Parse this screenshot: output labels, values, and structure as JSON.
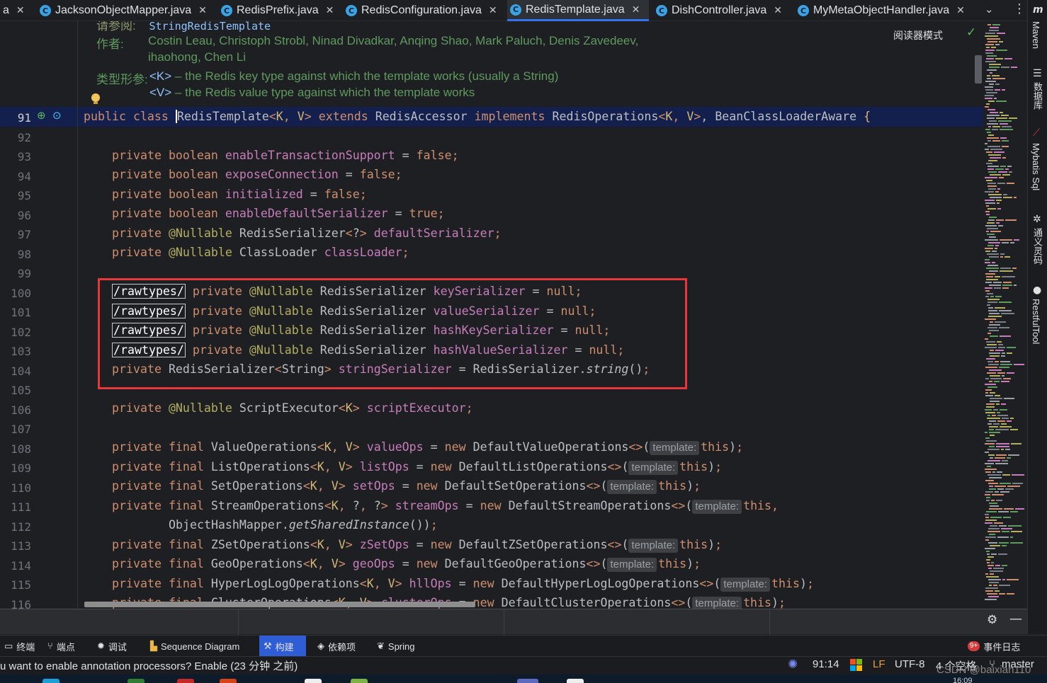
{
  "tabs": [
    {
      "label": "a",
      "partial": true
    },
    {
      "label": "JacksonObjectMapper.java"
    },
    {
      "label": "RedisPrefix.java"
    },
    {
      "label": "RedisConfiguration.java"
    },
    {
      "label": "RedisTemplate.java",
      "active": true
    },
    {
      "label": "DishController.java"
    },
    {
      "label": "MyMetaObjectHandler.java"
    }
  ],
  "editor": {
    "reader_mode": "阅读器模式",
    "doc": {
      "see_label": "请参阅:",
      "see_value": "StringRedisTemplate",
      "author_label": "作者:",
      "authors_line1": "Costin Leau, Christoph Strobl, Ninad Divadkar, Anqing Shao, Mark Paluch, Denis Zavedeev,",
      "authors_line2": "ihaohong, Chen Li",
      "type_params_label": "类型形参:",
      "k_param": "<K>",
      "k_desc": " – the Redis key type against which the template works (usually a String)",
      "v_param": "<V>",
      "v_desc": " – the Redis value type against which the template works"
    },
    "line_numbers": [
      "91",
      "92",
      "93",
      "94",
      "95",
      "96",
      "97",
      "98",
      "99",
      "100",
      "101",
      "102",
      "103",
      "104",
      "105",
      "106",
      "107",
      "108",
      "109",
      "110",
      "111",
      "112",
      "113",
      "114",
      "115",
      "116"
    ],
    "code": {
      "l91": {
        "public": "public",
        "class": "class",
        "name": "RedisTemplate",
        "k": "K",
        "v": "V",
        "extends": "extends",
        "accessor": "RedisAccessor",
        "implements": "implements",
        "ops": "RedisOperations",
        "aware": "BeanClassLoaderAware"
      },
      "private": "private",
      "boolean": "boolean",
      "final": "final",
      "nullable": "@Nullable",
      "false": "false",
      "true": "true",
      "null": "null",
      "new": "new",
      "this": "this",
      "rawtypes": "/rawtypes/",
      "hint": "template:",
      "f_enableTx": "enableTransactionSupport",
      "f_expose": "exposeConnection",
      "f_init": "initialized",
      "f_enableDef": "enableDefaultSerializer",
      "t_serializer": "RedisSerializer",
      "f_defSer": "defaultSerializer",
      "t_classloader": "ClassLoader",
      "f_classLoader": "classLoader",
      "f_keySer": "keySerializer",
      "f_valueSer": "valueSerializer",
      "f_hashKeySer": "hashKeySerializer",
      "f_hashValueSer": "hashValueSerializer",
      "t_string": "String",
      "f_strSer": "stringSerializer",
      "m_string": "string",
      "t_scriptExec": "ScriptExecutor",
      "f_scriptExec": "scriptExecutor",
      "t_valueOps": "ValueOperations",
      "f_valueOps": "valueOps",
      "c_valueOps": "DefaultValueOperations",
      "t_listOps": "ListOperations",
      "f_listOps": "listOps",
      "c_listOps": "DefaultListOperations",
      "t_setOps": "SetOperations",
      "f_setOps": "setOps",
      "c_setOps": "DefaultSetOperations",
      "t_streamOps": "StreamOperations",
      "f_streamOps": "streamOps",
      "c_streamOps": "DefaultStreamOperations",
      "t_hashMapper": "ObjectHashMapper",
      "m_shared": "getSharedInstance",
      "t_zsetOps": "ZSetOperations",
      "f_zsetOps": "zSetOps",
      "c_zsetOps": "DefaultZSetOperations",
      "t_geoOps": "GeoOperations",
      "f_geoOps": "geoOps",
      "c_geoOps": "DefaultGeoOperations",
      "t_hllOps": "HyperLogLogOperations",
      "f_hllOps": "hllOps",
      "c_hllOps": "DefaultHyperLogLogOperations",
      "t_clusterOps": "ClusterOperations",
      "f_clusterOps": "clusterOps",
      "c_clusterOps": "DefaultClusterOperations"
    }
  },
  "right_tools": [
    "Maven",
    "数据库",
    "Mybatis Sql",
    "通义灵码",
    "RestfulTool"
  ],
  "tool_windows": [
    {
      "label": "终端",
      "icon": "terminal-icon"
    },
    {
      "label": "端点",
      "icon": "endpoints-icon"
    },
    {
      "label": "调试",
      "icon": "debug-icon"
    },
    {
      "label": "Sequence Diagram",
      "icon": "sequence-icon"
    },
    {
      "label": "构建",
      "icon": "build-icon",
      "active": true
    },
    {
      "label": "依赖项",
      "icon": "dependencies-icon"
    },
    {
      "label": "Spring",
      "icon": "spring-icon"
    }
  ],
  "event_log": {
    "badge": "9+",
    "label": "事件日志"
  },
  "status": {
    "message": "u want to enable annotation processors? Enable (23 分钟 之前)",
    "position": "91:14",
    "line_sep": "LF",
    "encoding": "UTF-8",
    "indent": "4 个空格",
    "branch": "master",
    "watermark": "CSDN @baixian110",
    "clock": "16:09"
  },
  "colors": {
    "accent": "#3574f0",
    "highlight_box": "#e5383b",
    "current_line": "#13204e"
  }
}
